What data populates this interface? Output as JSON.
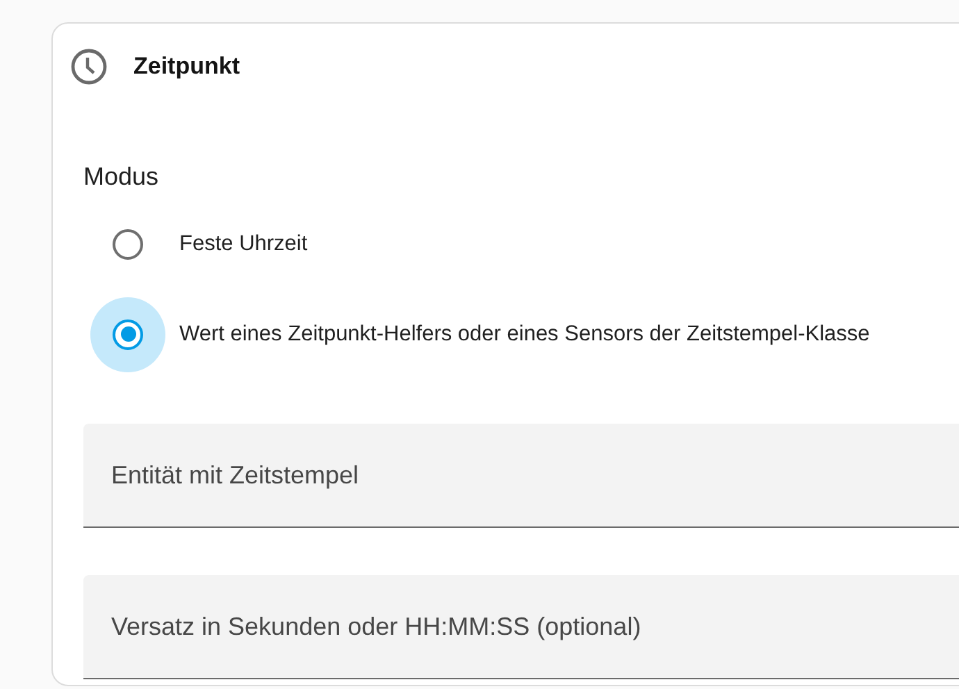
{
  "card": {
    "title": "Zeitpunkt"
  },
  "mode": {
    "label": "Modus",
    "options": [
      {
        "label": "Feste Uhrzeit",
        "selected": false
      },
      {
        "label": "Wert eines Zeitpunkt-Helfers oder eines Sensors der Zeitstempel-Klasse",
        "selected": true
      }
    ]
  },
  "fields": [
    {
      "placeholder": "Entität mit Zeitstempel"
    },
    {
      "placeholder": "Versatz in Sekunden oder HH:MM:SS (optional)"
    }
  ]
}
